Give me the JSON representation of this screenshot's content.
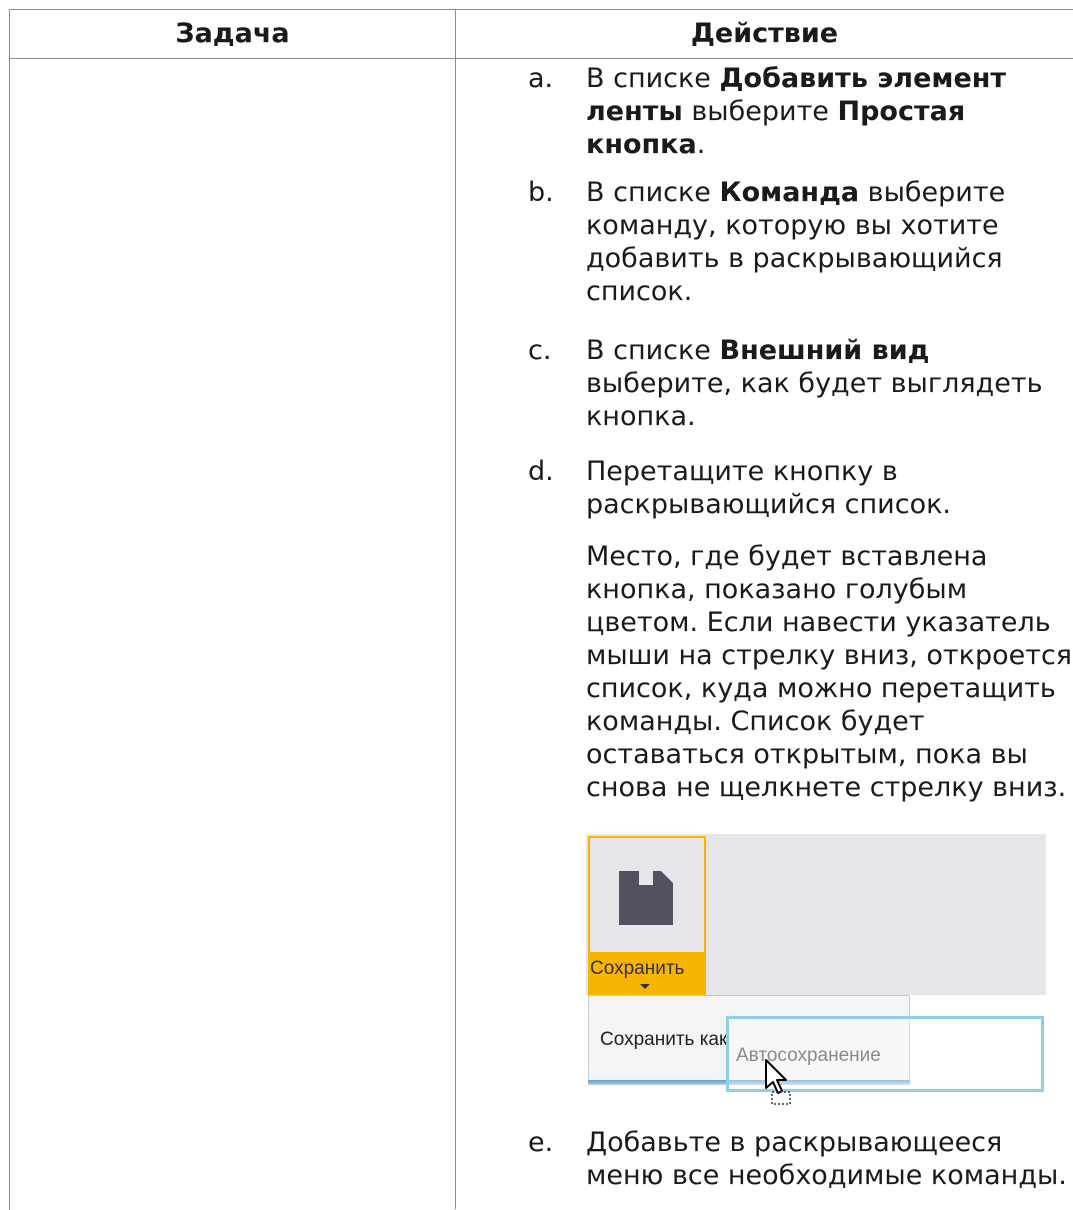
{
  "table": {
    "headers": {
      "task": "Задача",
      "action": "Действие"
    }
  },
  "steps": [
    {
      "letter": "a.",
      "parts": [
        {
          "t": "В списке ",
          "b": false
        },
        {
          "t": "Добавить элемент ленты",
          "b": true
        },
        {
          "t": " выберите ",
          "b": false
        },
        {
          "t": "Простая кнопка",
          "b": true
        },
        {
          "t": ".",
          "b": false
        }
      ]
    },
    {
      "letter": "b.",
      "parts": [
        {
          "t": "В списке ",
          "b": false
        },
        {
          "t": "Команда",
          "b": true
        },
        {
          "t": " выберите команду, которую вы хотите добавить в раскрывающийся список.",
          "b": false
        }
      ]
    },
    {
      "letter": "c.",
      "parts": [
        {
          "t": "В списке ",
          "b": false
        },
        {
          "t": "Внешний вид",
          "b": true
        },
        {
          "t": " выберите, как будет выглядеть кнопка.",
          "b": false
        }
      ]
    },
    {
      "letter": "d.",
      "parts": [
        {
          "t": "Перетащите кнопку в раскрывающийся список.",
          "b": false
        }
      ]
    },
    {
      "letter": "e.",
      "parts": [
        {
          "t": "Добавьте в раскрывающееся меню все необходимые команды.",
          "b": false
        }
      ]
    }
  ],
  "note": "Место, где будет вставлена кнопка, показано голубым цветом. Если навести указатель мыши на стрелку вниз, откроется список, куда можно перетащить команды. Список будет оставаться открытым, пока вы снова не щелкнете стрелку вниз.",
  "screenshot": {
    "button_label": "Сохранить",
    "menu_item": "Сохранить как",
    "drag_item": "Автосохранение",
    "icons": [
      "save-disk-icon",
      "dropdown-arrow-icon",
      "drag-cursor-icon"
    ],
    "colors": {
      "highlight": "#f7b500",
      "drop_target": "#8fd0e6",
      "ribbon": "#e6e5ea"
    }
  }
}
